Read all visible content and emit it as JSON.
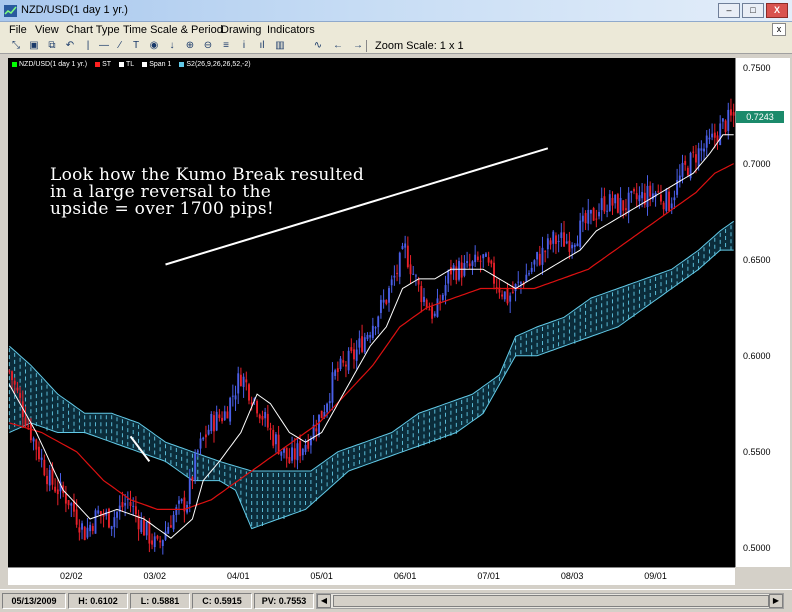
{
  "window": {
    "title": "NZD/USD(1 day  1 yr.)",
    "minimize": "–",
    "maximize": "□",
    "close": "X"
  },
  "menu": {
    "items": [
      "File",
      "View",
      "Chart Type",
      "Time Scale & Period",
      "Drawing",
      "Indicators"
    ],
    "close": "x"
  },
  "toolbar": {
    "icons": [
      "zoom-fit-icon",
      "print-icon",
      "copy-icon",
      "undo-icon",
      "vertical-line-icon",
      "horizontal-line-icon",
      "trend-line-icon",
      "text-icon",
      "circle-icon",
      "arrow-down-icon",
      "zoom-in-icon",
      "zoom-out-icon",
      "bar-chart-icon",
      "info-icon",
      "histogram-icon",
      "candlestick-icon",
      "line-chart-icon",
      "scroll-left-icon",
      "scroll-right-icon"
    ],
    "glyphs": [
      "⤡",
      "▣",
      "⧉",
      "↶",
      "|",
      "—",
      "∕",
      "T",
      "◉",
      "↓",
      "⊕",
      "⊖",
      "≡",
      "i",
      "ıl",
      "▥",
      "∿",
      "←",
      "→"
    ],
    "zoom_label": "Zoom Scale: 1 x 1"
  },
  "legend": [
    {
      "label": "NZD/USD(1 day  1 yr.)",
      "color": "#00ff00"
    },
    {
      "label": "ST",
      "color": "#ff2020"
    },
    {
      "label": "TL",
      "color": "#ffffff"
    },
    {
      "label": "Span 1",
      "color": "#ffffff"
    },
    {
      "label": "S2(26,9,26,26,52,-2)",
      "color": "#62c9e6"
    }
  ],
  "annotation": {
    "lines": [
      "Look how the Kumo Break resulted",
      "in a large reversal to the",
      "upside = over 1700 pips!"
    ]
  },
  "chart_data": {
    "type": "candlestick",
    "ylim": [
      0.49,
      0.755
    ],
    "ytick_labels": [
      "0.7500",
      "0.7000",
      "0.6500",
      "0.6000",
      "0.5500",
      "0.5000"
    ],
    "yticks": [
      0.75,
      0.7,
      0.65,
      0.6,
      0.55,
      0.5
    ],
    "x_labels": [
      "02/02",
      "03/02",
      "04/01",
      "05/01",
      "06/01",
      "07/01",
      "08/03",
      "09/01"
    ],
    "x_label_idx": [
      23,
      54,
      85,
      116,
      147,
      178,
      209,
      240
    ],
    "n_bars": 270,
    "last_price": "0.7243",
    "colors": {
      "up": "#4a5fe8",
      "down": "#e8202a",
      "tenkan": "#ffffff",
      "kijun": "#dd1111",
      "cloud": "#62c9e6"
    },
    "close_anchors": [
      [
        0,
        0.592
      ],
      [
        8,
        0.56
      ],
      [
        15,
        0.535
      ],
      [
        22,
        0.525
      ],
      [
        28,
        0.508
      ],
      [
        33,
        0.518
      ],
      [
        38,
        0.515
      ],
      [
        44,
        0.525
      ],
      [
        50,
        0.51
      ],
      [
        55,
        0.5
      ],
      [
        60,
        0.515
      ],
      [
        66,
        0.525
      ],
      [
        70,
        0.55
      ],
      [
        75,
        0.565
      ],
      [
        80,
        0.57
      ],
      [
        86,
        0.59
      ],
      [
        92,
        0.575
      ],
      [
        97,
        0.56
      ],
      [
        104,
        0.545
      ],
      [
        110,
        0.555
      ],
      [
        116,
        0.57
      ],
      [
        121,
        0.59
      ],
      [
        128,
        0.6
      ],
      [
        134,
        0.615
      ],
      [
        140,
        0.63
      ],
      [
        147,
        0.655
      ],
      [
        152,
        0.635
      ],
      [
        158,
        0.62
      ],
      [
        164,
        0.645
      ],
      [
        170,
        0.645
      ],
      [
        176,
        0.65
      ],
      [
        180,
        0.64
      ],
      [
        185,
        0.63
      ],
      [
        190,
        0.638
      ],
      [
        196,
        0.65
      ],
      [
        202,
        0.66
      ],
      [
        208,
        0.66
      ],
      [
        215,
        0.67
      ],
      [
        221,
        0.68
      ],
      [
        228,
        0.678
      ],
      [
        234,
        0.682
      ],
      [
        240,
        0.685
      ],
      [
        245,
        0.68
      ],
      [
        250,
        0.695
      ],
      [
        255,
        0.705
      ],
      [
        260,
        0.71
      ],
      [
        265,
        0.72
      ],
      [
        269,
        0.7243
      ]
    ],
    "tenkan_anchors": [
      [
        0,
        0.585
      ],
      [
        10,
        0.56
      ],
      [
        20,
        0.53
      ],
      [
        30,
        0.515
      ],
      [
        40,
        0.52
      ],
      [
        50,
        0.515
      ],
      [
        60,
        0.505
      ],
      [
        68,
        0.515
      ],
      [
        72,
        0.535
      ],
      [
        78,
        0.545
      ],
      [
        86,
        0.56
      ],
      [
        92,
        0.58
      ],
      [
        97,
        0.575
      ],
      [
        104,
        0.56
      ],
      [
        110,
        0.555
      ],
      [
        116,
        0.56
      ],
      [
        122,
        0.575
      ],
      [
        128,
        0.59
      ],
      [
        134,
        0.605
      ],
      [
        140,
        0.615
      ],
      [
        146,
        0.635
      ],
      [
        152,
        0.64
      ],
      [
        158,
        0.64
      ],
      [
        164,
        0.645
      ],
      [
        170,
        0.645
      ],
      [
        176,
        0.645
      ],
      [
        182,
        0.64
      ],
      [
        188,
        0.635
      ],
      [
        194,
        0.64
      ],
      [
        200,
        0.645
      ],
      [
        206,
        0.65
      ],
      [
        212,
        0.655
      ],
      [
        218,
        0.665
      ],
      [
        224,
        0.67
      ],
      [
        230,
        0.675
      ],
      [
        236,
        0.68
      ],
      [
        242,
        0.685
      ],
      [
        248,
        0.69
      ],
      [
        254,
        0.695
      ],
      [
        260,
        0.705
      ],
      [
        265,
        0.715
      ],
      [
        269,
        0.715
      ]
    ],
    "kijun_anchors": [
      [
        0,
        0.565
      ],
      [
        12,
        0.56
      ],
      [
        25,
        0.55
      ],
      [
        35,
        0.535
      ],
      [
        45,
        0.525
      ],
      [
        55,
        0.52
      ],
      [
        65,
        0.52
      ],
      [
        75,
        0.525
      ],
      [
        85,
        0.535
      ],
      [
        95,
        0.545
      ],
      [
        105,
        0.555
      ],
      [
        115,
        0.565
      ],
      [
        125,
        0.58
      ],
      [
        135,
        0.595
      ],
      [
        145,
        0.615
      ],
      [
        155,
        0.625
      ],
      [
        165,
        0.63
      ],
      [
        175,
        0.635
      ],
      [
        185,
        0.635
      ],
      [
        195,
        0.635
      ],
      [
        205,
        0.64
      ],
      [
        215,
        0.645
      ],
      [
        225,
        0.655
      ],
      [
        235,
        0.665
      ],
      [
        245,
        0.675
      ],
      [
        255,
        0.685
      ],
      [
        262,
        0.695
      ],
      [
        269,
        0.7
      ]
    ],
    "span_a_anchors": [
      [
        0,
        0.605
      ],
      [
        8,
        0.595
      ],
      [
        18,
        0.58
      ],
      [
        28,
        0.57
      ],
      [
        38,
        0.57
      ],
      [
        48,
        0.565
      ],
      [
        58,
        0.555
      ],
      [
        68,
        0.55
      ],
      [
        78,
        0.545
      ],
      [
        90,
        0.54
      ],
      [
        102,
        0.54
      ],
      [
        112,
        0.54
      ],
      [
        122,
        0.55
      ],
      [
        132,
        0.555
      ],
      [
        142,
        0.56
      ],
      [
        152,
        0.57
      ],
      [
        162,
        0.575
      ],
      [
        172,
        0.58
      ],
      [
        182,
        0.59
      ],
      [
        188,
        0.61
      ],
      [
        196,
        0.615
      ],
      [
        206,
        0.62
      ],
      [
        216,
        0.63
      ],
      [
        226,
        0.635
      ],
      [
        236,
        0.64
      ],
      [
        246,
        0.645
      ],
      [
        256,
        0.655
      ],
      [
        264,
        0.665
      ],
      [
        269,
        0.67
      ]
    ],
    "span_b_anchors": [
      [
        0,
        0.56
      ],
      [
        8,
        0.565
      ],
      [
        18,
        0.56
      ],
      [
        28,
        0.56
      ],
      [
        38,
        0.555
      ],
      [
        48,
        0.55
      ],
      [
        58,
        0.545
      ],
      [
        68,
        0.535
      ],
      [
        78,
        0.535
      ],
      [
        84,
        0.53
      ],
      [
        90,
        0.51
      ],
      [
        100,
        0.515
      ],
      [
        110,
        0.52
      ],
      [
        118,
        0.53
      ],
      [
        126,
        0.54
      ],
      [
        136,
        0.545
      ],
      [
        146,
        0.55
      ],
      [
        156,
        0.555
      ],
      [
        166,
        0.56
      ],
      [
        176,
        0.57
      ],
      [
        182,
        0.585
      ],
      [
        188,
        0.6
      ],
      [
        196,
        0.6
      ],
      [
        206,
        0.605
      ],
      [
        216,
        0.61
      ],
      [
        226,
        0.615
      ],
      [
        236,
        0.625
      ],
      [
        246,
        0.635
      ],
      [
        256,
        0.645
      ],
      [
        264,
        0.655
      ],
      [
        269,
        0.655
      ]
    ],
    "trend_lines": [
      [
        [
          45,
          0.558
        ],
        [
          52,
          0.545
        ]
      ],
      [
        [
          58,
          0.6475
        ],
        [
          200,
          0.708
        ]
      ]
    ]
  },
  "status": {
    "date": "05/13/2009",
    "high": "H: 0.6102",
    "low": "L: 0.5881",
    "close": "C: 0.5915",
    "pv": "PV: 0.7553",
    "scroll_left": "◀",
    "scroll_right": "▶"
  }
}
